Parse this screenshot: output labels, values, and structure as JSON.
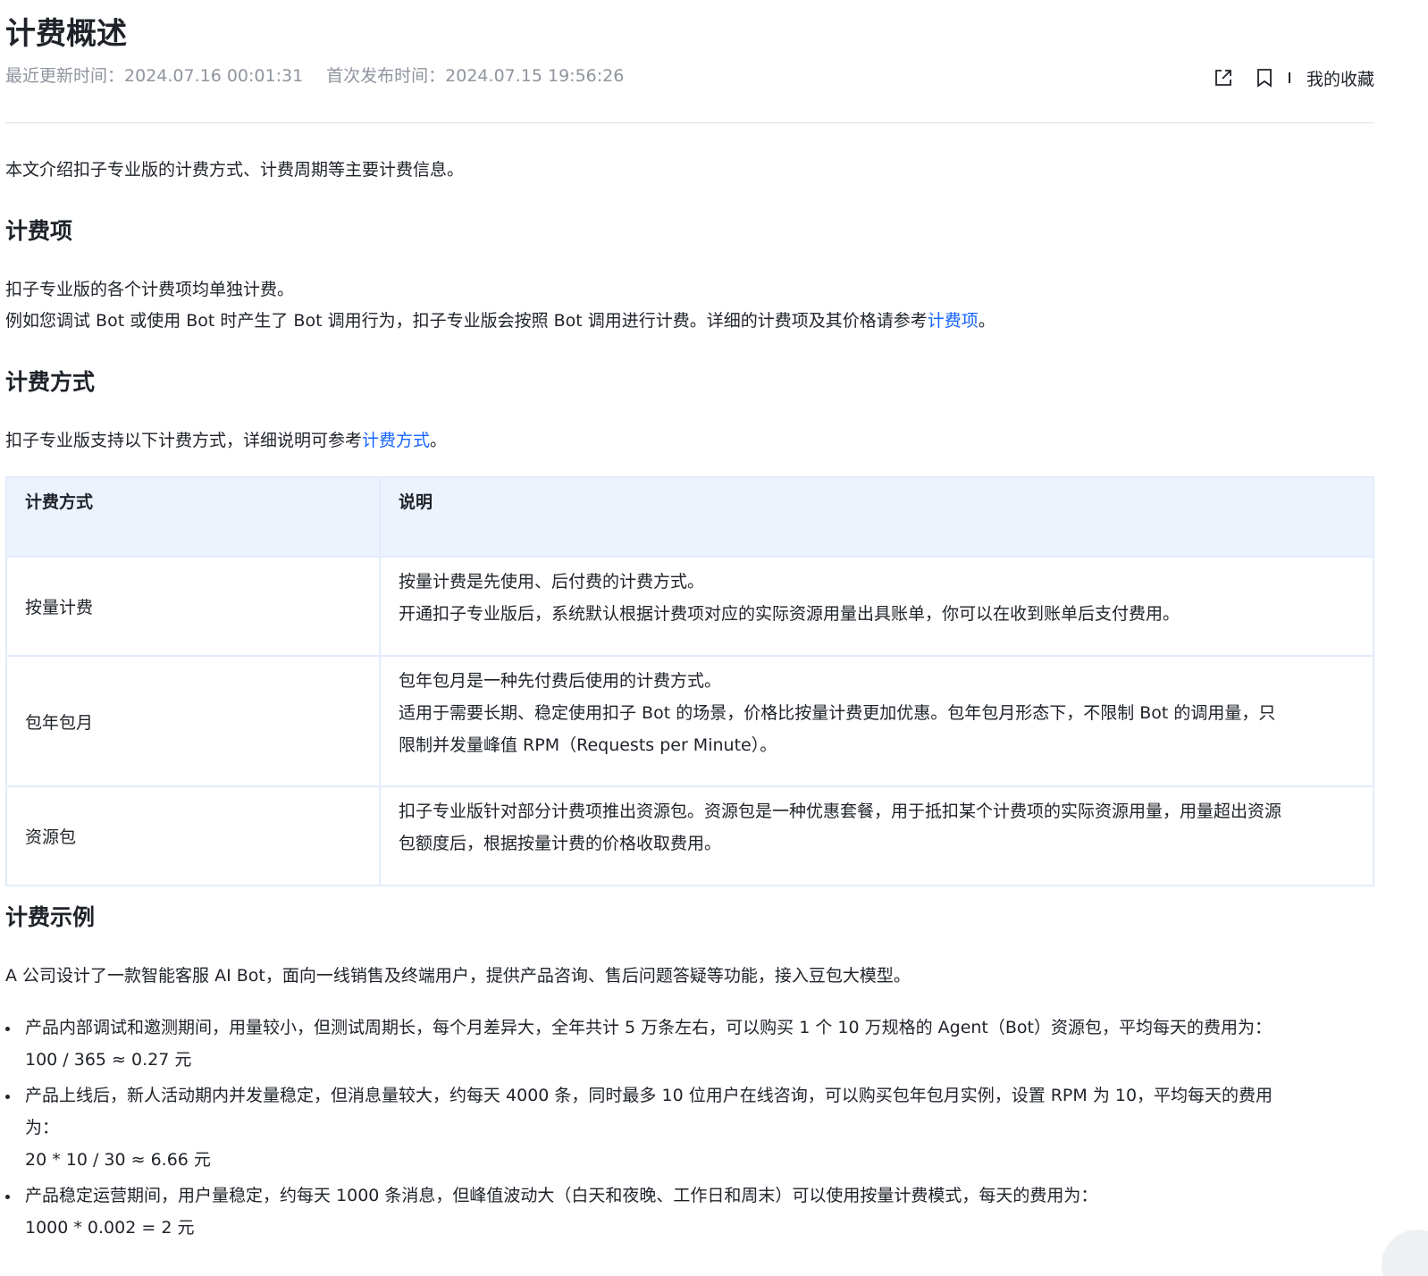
{
  "header": {
    "title": "计费概述",
    "updated": "最近更新时间：2024.07.16 00:01:31",
    "published": "首次发布时间：2024.07.15 19:56:26",
    "favorites_label": "我的收藏"
  },
  "intro": "本文介绍扣子专业版的计费方式、计费周期等主要计费信息。",
  "sections": {
    "items": {
      "heading": "计费项",
      "line1": "扣子专业版的各个计费项均单独计费。",
      "line2_prefix": "例如您调试 Bot 或使用 Bot 时产生了 Bot 调用行为，扣子专业版会按照 Bot 调用进行计费。详细的计费项及其价格请参考",
      "line2_link": "计费项",
      "line2_suffix": "。"
    },
    "methods": {
      "heading": "计费方式",
      "line_prefix": "扣子专业版支持以下计费方式，详细说明可参考",
      "line_link": "计费方式",
      "line_suffix": "。"
    },
    "example": {
      "heading": "计费示例",
      "intro": "A 公司设计了一款智能客服 AI Bot，面向一线销售及终端用户，提供产品咨询、售后问题答疑等功能，接入豆包大模型。"
    }
  },
  "table": {
    "headers": [
      "计费方式",
      "说明"
    ],
    "rows": [
      {
        "method": "按量计费",
        "desc": [
          "按量计费是先使用、后付费的计费方式。",
          "开通扣子专业版后，系统默认根据计费项对应的实际资源用量出具账单，你可以在收到账单后支付费用。"
        ]
      },
      {
        "method": "包年包月",
        "desc": [
          "包年包月是一种先付费后使用的计费方式。",
          "适用于需要长期、稳定使用扣子 Bot 的场景，价格比按量计费更加优惠。包年包月形态下，不限制 Bot 的调用量，只",
          "限制并发量峰值 RPM（Requests per Minute）。"
        ]
      },
      {
        "method": "资源包",
        "desc": [
          "扣子专业版针对部分计费项推出资源包。资源包是一种优惠套餐，用于抵扣某个计费项的实际资源用量，用量超出资源",
          "包额度后，根据按量计费的价格收取费用。"
        ]
      }
    ]
  },
  "bullets": [
    {
      "lines": [
        "产品内部调试和邀测期间，用量较小，但测试周期长，每个月差异大，全年共计 5 万条左右，可以购买 1 个 10 万规格的 Agent（Bot）资源包，平均每天的费用为：",
        "100 / 365 ≈ 0.27 元"
      ]
    },
    {
      "lines": [
        "产品上线后，新人活动期内并发量稳定，但消息量较大，约每天 4000 条，同时最多 10 位用户在线咨询，可以购买包年包月实例，设置 RPM 为 10，平均每天的费用",
        "为：",
        "20 * 10 / 30 ≈ 6.66 元"
      ]
    },
    {
      "lines": [
        "产品稳定运营期间，用户量稳定，约每天 1000 条消息，但峰值波动大（白天和夜晚、工作日和周末）可以使用按量计费模式，每天的费用为：",
        "1000 * 0.002 = 2 元"
      ]
    }
  ],
  "icons": {
    "share": "external-link-icon",
    "bookmark": "bookmark-icon"
  },
  "colors": {
    "link": "#1664ff",
    "table_header_bg": "#edf3fd",
    "meta_text": "#8f959e"
  }
}
